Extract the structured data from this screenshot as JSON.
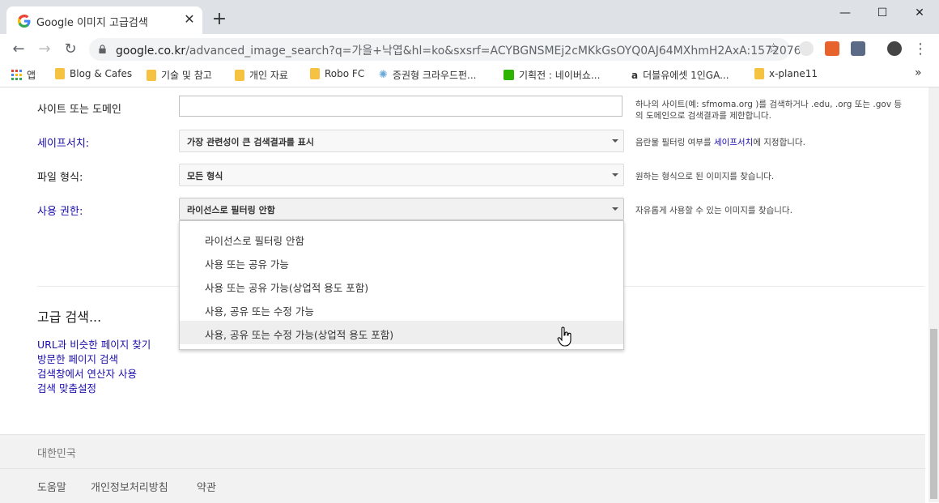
{
  "browser": {
    "tab_title": "Google 이미지 고급검색",
    "tab_close": "✕",
    "new_tab": "+",
    "window": {
      "minimize": "—",
      "maximize": "☐",
      "close": "✕"
    },
    "url_host": "google.co.kr",
    "url_path": "/advanced_image_search?q=가을+낙엽&hl=ko&sxsrf=ACYBGNSMEj2cMKkGsOYQ0AJ64MXhmH2AxA:1572076...",
    "nav": {
      "back": "←",
      "forward": "→",
      "reload": "↻",
      "star": "☆",
      "menu": "⋮"
    },
    "bookmarks": [
      {
        "label": "앱",
        "icon": "apps-grid-icon"
      },
      {
        "label": "Blog & Cafes",
        "icon": "folder-icon"
      },
      {
        "label": "기술 및 참고",
        "icon": "folder-icon"
      },
      {
        "label": "개인 자료",
        "icon": "folder-icon"
      },
      {
        "label": "Robo FC",
        "icon": "folder-icon"
      },
      {
        "label": "증권형 크라우드펀...",
        "icon": "sparkle-icon"
      },
      {
        "label": "기획전 : 네이버쇼...",
        "icon": "naver-icon"
      },
      {
        "label": "더블유에셋 1인GA...",
        "icon": "amazon-a-icon"
      },
      {
        "label": "x-plane11",
        "icon": "folder-icon"
      }
    ],
    "bookmarks_more": "»"
  },
  "form": {
    "site_label": "사이트 또는 도메인",
    "site_value": "",
    "site_hint_line1": "하나의 사이트(예: sfmoma.org )를 검색하거나 .edu, .org 또는 .gov 등",
    "site_hint_line2": "의 도메인으로 검색결과를 제한합니다.",
    "safesearch_label": "세이프서치:",
    "safesearch_value": "가장 관련성이 큰 검색결과를 표시",
    "safesearch_hint_pre": "음란물 필터링 여부를 ",
    "safesearch_hint_link": "세이프서치",
    "safesearch_hint_post": "에 지정합니다.",
    "filetype_label": "파일 형식:",
    "filetype_value": "모든 형식",
    "filetype_hint": "원하는 형식으로 된 이미지를 찾습니다.",
    "rights_label": "사용 권한:",
    "rights_value": "라이선스로 필터링 안함",
    "rights_hint": "자유롭게 사용할 수 있는 이미지를 찾습니다.",
    "rights_options": [
      "라이선스로 필터링 안함",
      "사용 또는 공유 가능",
      "사용 또는 공유 가능(상업적 용도 포함)",
      "사용, 공유 또는 수정 가능",
      "사용, 공유 또는 수정 가능(상업적 용도 포함)"
    ]
  },
  "advanced": {
    "title": "고급 검색...",
    "links": [
      "URL과 비슷한 페이지 찾기",
      "방문한 페이지 검색",
      "검색창에서 연산자 사용",
      "검색 맞춤설정"
    ]
  },
  "footer": {
    "country": "대한민국",
    "links": [
      "도움말",
      "개인정보처리방침",
      "약관"
    ]
  }
}
